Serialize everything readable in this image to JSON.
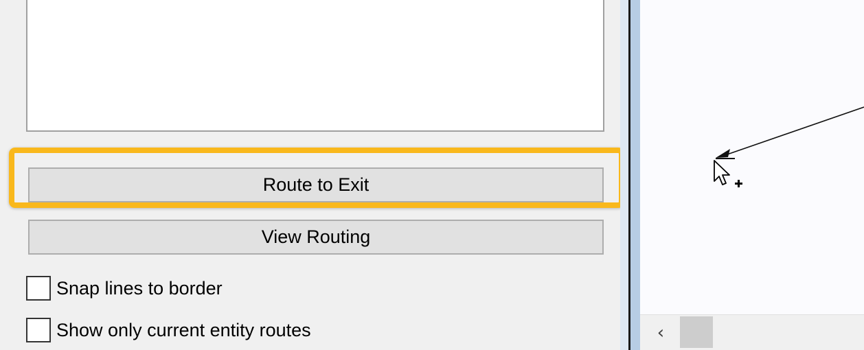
{
  "routing_panel": {
    "route_to_exit_label": "Route to Exit",
    "view_routing_label": "View Routing",
    "snap_lines_label": "Snap lines to border",
    "snap_lines_checked": false,
    "show_current_routes_label": "Show only current entity routes",
    "show_current_routes_checked": false
  },
  "highlight": {
    "color": "#f9b81c",
    "target": "Route to Exit"
  },
  "canvas": {
    "cursor": "arrow-with-plus",
    "background": "#fbfbfe"
  },
  "scrollbar": {
    "left_arrow": "‹",
    "left_arrow_icon": "chevron-left-icon"
  }
}
